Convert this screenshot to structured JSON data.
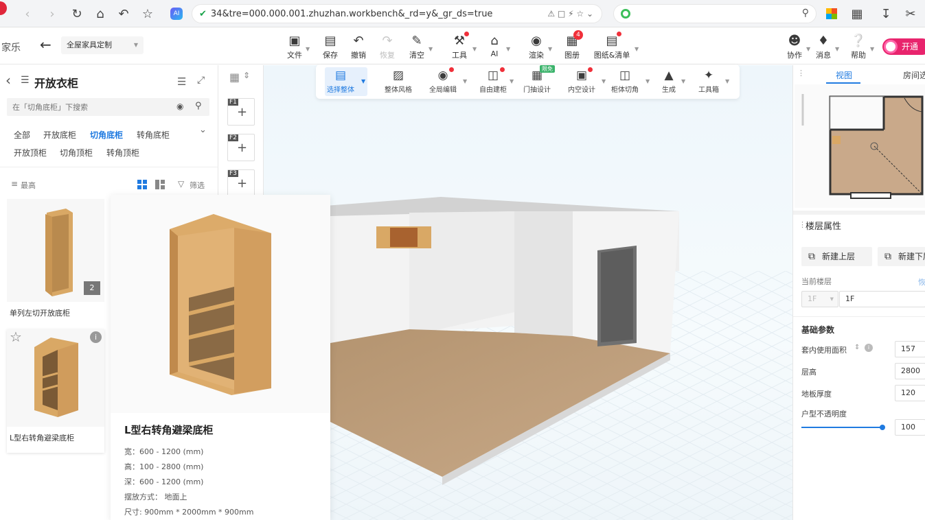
{
  "browser": {
    "url": "34&tre=000.000.001.zhuzhan.workbench&_rd=y&_gr_ds=true"
  },
  "header": {
    "app_name": "家乐",
    "breadcrumb_select": "全屋家具定制",
    "tools": [
      {
        "label": "文件",
        "icon": "file-icon"
      },
      {
        "label": "保存",
        "icon": "save-icon"
      },
      {
        "label": "撤销",
        "icon": "undo-icon"
      },
      {
        "label": "恢复",
        "icon": "redo-icon"
      },
      {
        "label": "清空",
        "icon": "eraser-icon"
      },
      {
        "label": "工具",
        "icon": "wrench-icon"
      },
      {
        "label": "AI",
        "icon": "ai-house-icon"
      },
      {
        "label": "渲染",
        "icon": "camera-icon"
      },
      {
        "label": "图册",
        "icon": "album-icon",
        "badge": "4"
      },
      {
        "label": "图纸&清单",
        "icon": "drawing-icon"
      },
      {
        "label": "协作",
        "icon": "collab-icon"
      },
      {
        "label": "消息",
        "icon": "bell-icon"
      },
      {
        "label": "帮助",
        "icon": "help-icon"
      }
    ],
    "vip_label": "开通"
  },
  "left": {
    "title": "开放衣柜",
    "search_placeholder": "在「切角底柜」下搜索",
    "categories_row1": [
      "全部",
      "开放底柜",
      "切角底柜",
      "转角底柜"
    ],
    "categories_row2": [
      "开放顶柜",
      "切角顶柜",
      "转角顶柜"
    ],
    "sort_label": "最高",
    "filter_label": "筛选",
    "items": [
      {
        "name": "单列左切开放底柜",
        "count": "2"
      },
      {
        "name": "L型右转角避梁底柜"
      }
    ]
  },
  "floors": [
    "F1",
    "F2",
    "F3"
  ],
  "toolbar2": [
    {
      "label": "选择整体",
      "active": true
    },
    {
      "label": "整体风格"
    },
    {
      "label": "全局编辑"
    },
    {
      "label": "自由建柜"
    },
    {
      "label": "门抽设计",
      "badge": "限免"
    },
    {
      "label": "内空设计"
    },
    {
      "label": "柜体切角"
    },
    {
      "label": "生成"
    },
    {
      "label": "工具箱"
    }
  ],
  "popup": {
    "title": "L型右转角避梁底柜",
    "width": "宽：600 - 1200 (mm)",
    "height": "高：100 - 2800 (mm)",
    "depth": "深：600 - 1200 (mm)",
    "placement": "摆放方式： 地面上",
    "size": "尺寸: 900mm * 2000mm * 900mm"
  },
  "right": {
    "tab_view": "视图",
    "tab_room": "房间选",
    "section_title": "楼层属性",
    "new_upper": "新建上层",
    "new_lower": "新建下层",
    "current_floor_label": "当前楼层",
    "current_floor_link": "恢",
    "floor_select": "1F",
    "floor_name": "1F",
    "basic_params": "基础参数",
    "area_label": "套内使用面积",
    "area_value": "157",
    "height_label": "层高",
    "height_value": "2800",
    "floor_thick_label": "地板厚度",
    "floor_thick_value": "120",
    "opacity_label": "户型不透明度",
    "opacity_value": "100",
    "opacity_fraction": 1.0
  },
  "colors": {
    "accent": "#1f7ae0",
    "badge_red": "#f0303a",
    "vip": "#e8246d"
  }
}
